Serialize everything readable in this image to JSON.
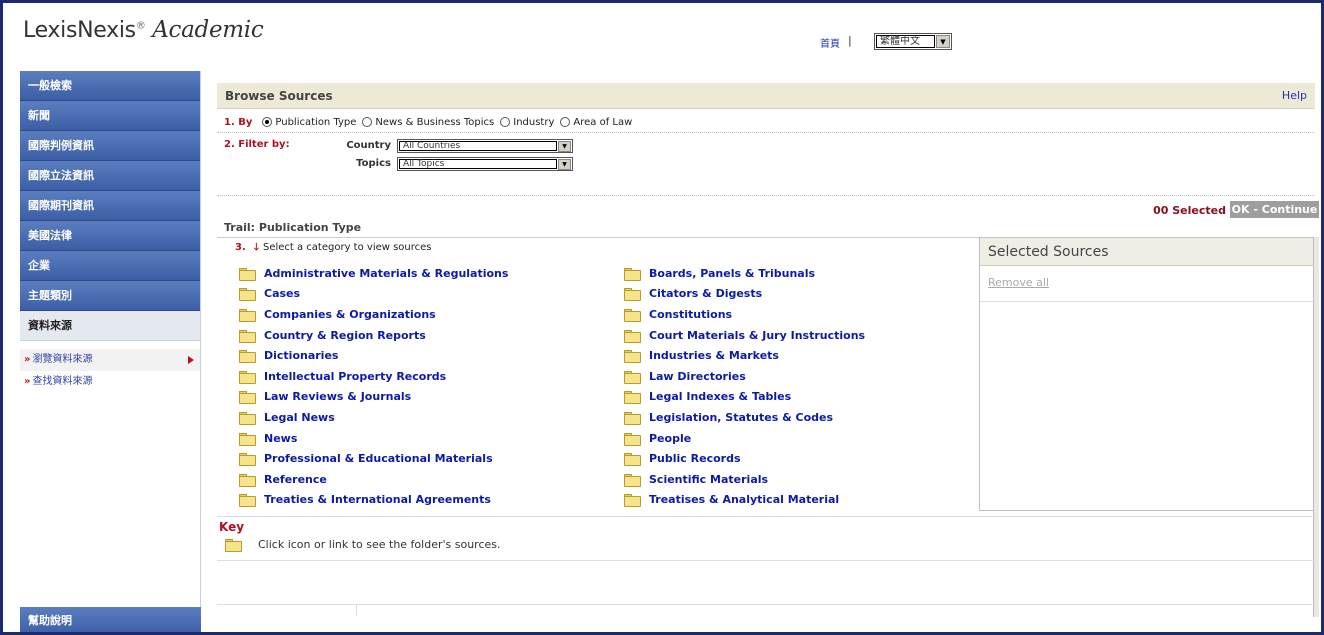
{
  "header": {
    "logo_brand": "LexisNexis",
    "logo_reg": "®",
    "logo_product": "Academic",
    "home_link": "首頁",
    "home_sep": "|",
    "language": "繁體中文"
  },
  "sidebar": {
    "items": [
      {
        "label": "一般檢索"
      },
      {
        "label": "新聞"
      },
      {
        "label": "國際判例資訊"
      },
      {
        "label": "國際立法資訊"
      },
      {
        "label": "國際期刊資訊"
      },
      {
        "label": "美國法律"
      },
      {
        "label": "企業"
      },
      {
        "label": "主題類別"
      },
      {
        "label": "資料來源"
      }
    ],
    "sub_items": [
      {
        "prefix": "»",
        "label": "瀏覽資料來源"
      },
      {
        "prefix": "»",
        "label": "查找資料來源"
      }
    ],
    "help": "幫助說明"
  },
  "browse": {
    "title": "Browse Sources",
    "help": "Help",
    "by_step": "1. By",
    "by_options": [
      "Publication Type",
      "News & Business Topics",
      "Industry",
      "Area of Law"
    ],
    "filter_step": "2. Filter by:",
    "country_label": "Country",
    "country_value": "All Countries",
    "topics_label": "Topics",
    "topics_value": "All Topics",
    "selected_count": "00 Selected",
    "ok_button": "OK - Continue",
    "trail": "Trail: Publication Type",
    "category_step": "3.",
    "category_instruction": "Select a category to view sources"
  },
  "categories_left": [
    "Administrative Materials & Regulations",
    "Cases",
    "Companies & Organizations",
    "Country & Region Reports",
    "Dictionaries",
    "Intellectual Property Records",
    "Law Reviews & Journals",
    "Legal News",
    "News",
    "Professional & Educational Materials",
    "Reference",
    "Treaties & International Agreements"
  ],
  "categories_right": [
    "Boards, Panels & Tribunals",
    "Citators & Digests",
    "Constitutions",
    "Court Materials & Jury Instructions",
    "Industries & Markets",
    "Law Directories",
    "Legal Indexes & Tables",
    "Legislation, Statutes & Codes",
    "People",
    "Public Records",
    "Scientific Materials",
    "Treatises & Analytical Material"
  ],
  "selected_sources": {
    "title": "Selected Sources",
    "remove_all": "Remove all"
  },
  "key": {
    "title": "Key",
    "text": "Click icon or link to see the folder's sources."
  },
  "icons": {
    "folder": "folder-icon",
    "down_arrow": "down-arrow-icon",
    "dropdown": "chevron-down-icon",
    "active_pointer": "triangle-right-icon"
  },
  "colors": {
    "nav_blue": "#3c5ea6",
    "link_blue": "#0c1aa8",
    "accent_red": "#b01020",
    "frame": "#1a2a6c"
  }
}
